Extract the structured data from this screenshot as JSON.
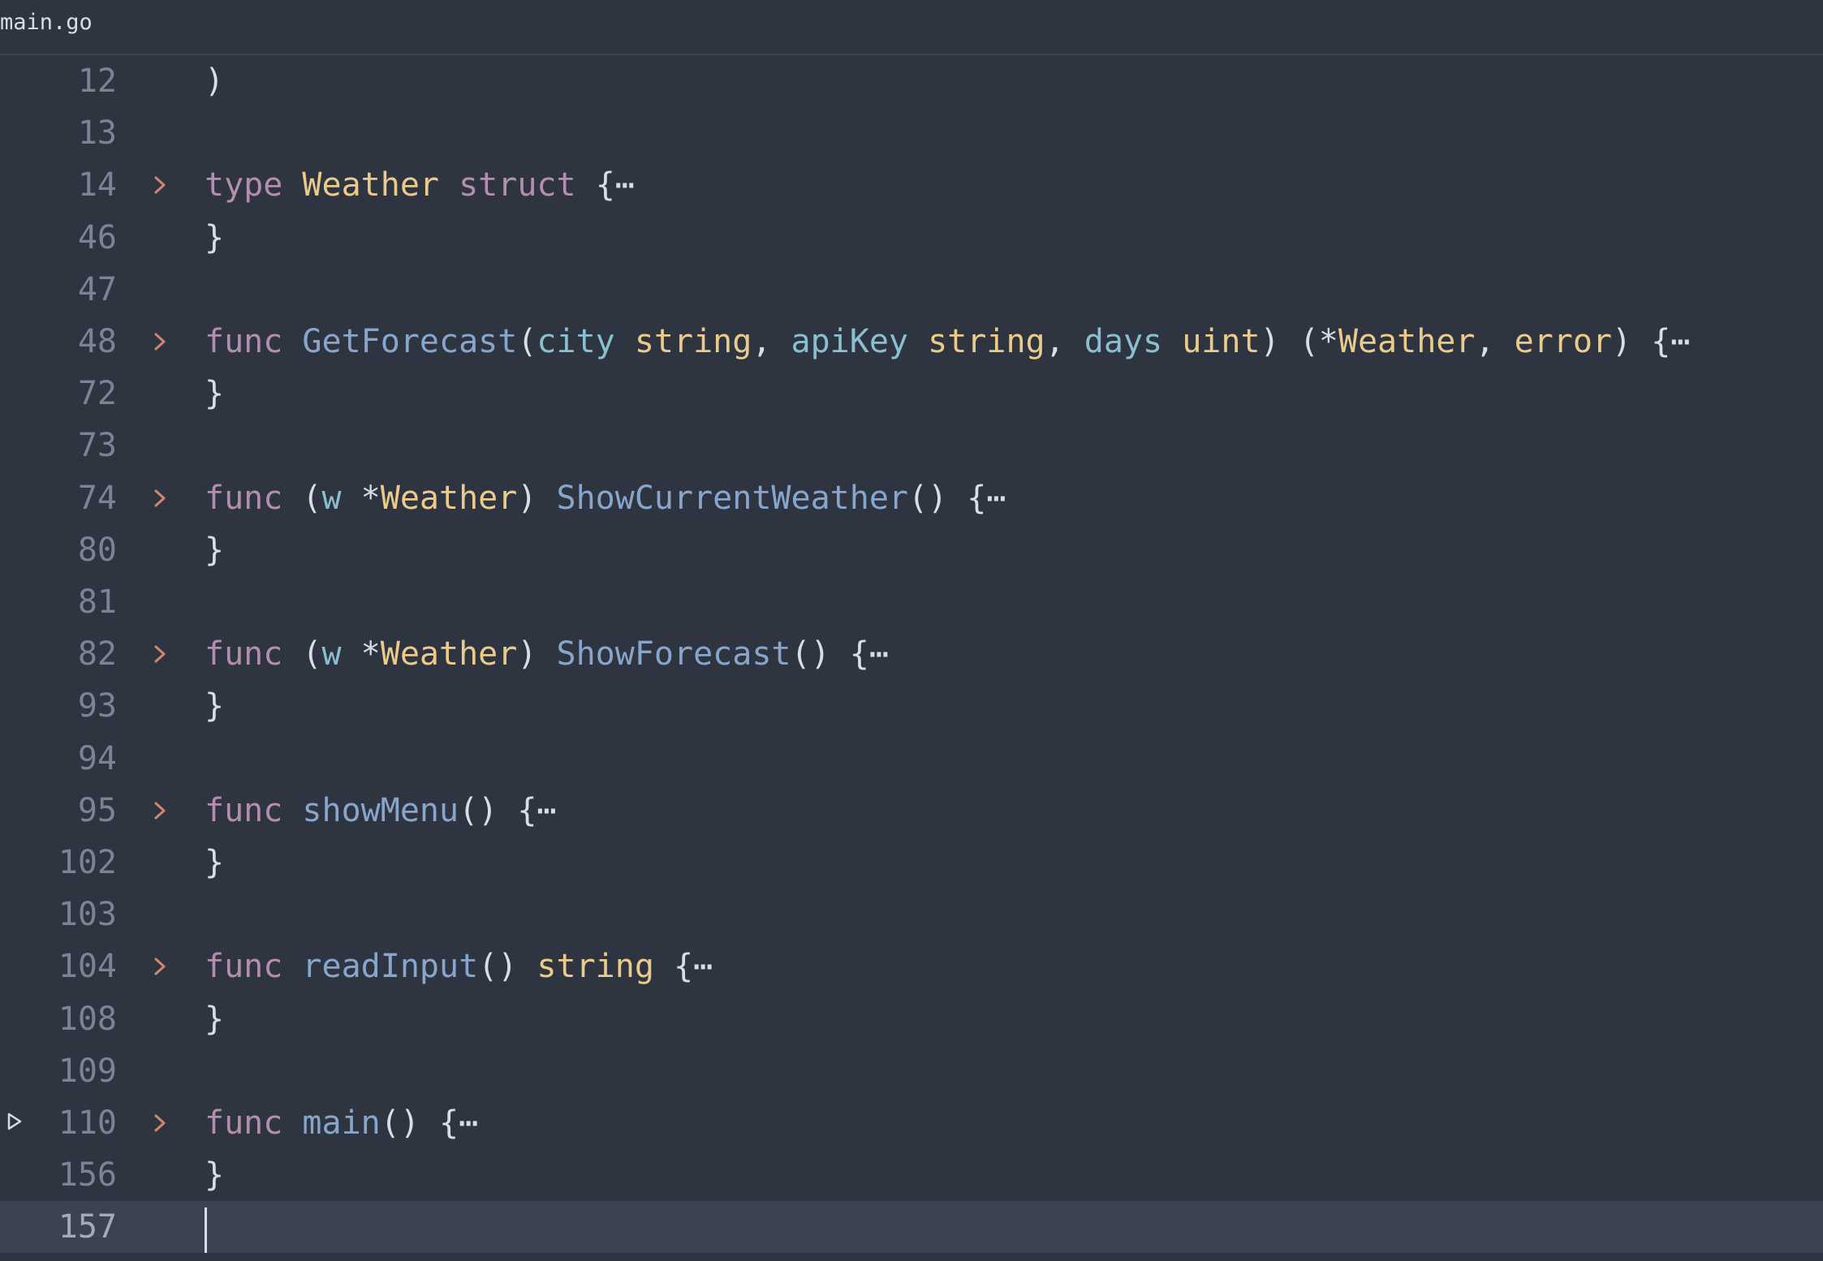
{
  "tab": {
    "title": "main.go"
  },
  "colors": {
    "background": "#2e3440",
    "current_line": "#3b4252",
    "keyword": "#b48ead",
    "type": "#ebcb8b",
    "function": "#88a6cc",
    "parameter": "#88c0d0",
    "fold_chevron": "#d08770"
  },
  "icons": {
    "fold": "chevron-right-icon",
    "run": "run-triangle-icon"
  },
  "ellipsis": "{⋯",
  "lines": [
    {
      "num": "12",
      "tokens": [
        {
          "t": ")",
          "c": "pu"
        }
      ]
    },
    {
      "num": "13",
      "tokens": []
    },
    {
      "num": "14",
      "fold": true,
      "tokens": [
        {
          "t": "type",
          "c": "kw"
        },
        {
          "t": " ",
          "c": "pu"
        },
        {
          "t": "Weather",
          "c": "ty"
        },
        {
          "t": " ",
          "c": "pu"
        },
        {
          "t": "struct",
          "c": "kw"
        },
        {
          "t": " ",
          "c": "pu"
        }
      ]
    },
    {
      "num": "46",
      "tokens": [
        {
          "t": "}",
          "c": "pu"
        }
      ]
    },
    {
      "num": "47",
      "tokens": []
    },
    {
      "num": "48",
      "fold": true,
      "tokens": [
        {
          "t": "func",
          "c": "kw"
        },
        {
          "t": " ",
          "c": "pu"
        },
        {
          "t": "GetForecast",
          "c": "fn"
        },
        {
          "t": "(",
          "c": "pu"
        },
        {
          "t": "city",
          "c": "pm"
        },
        {
          "t": " ",
          "c": "pu"
        },
        {
          "t": "string",
          "c": "ty"
        },
        {
          "t": ", ",
          "c": "pu"
        },
        {
          "t": "apiKey",
          "c": "pm"
        },
        {
          "t": " ",
          "c": "pu"
        },
        {
          "t": "string",
          "c": "ty"
        },
        {
          "t": ", ",
          "c": "pu"
        },
        {
          "t": "days",
          "c": "pm"
        },
        {
          "t": " ",
          "c": "pu"
        },
        {
          "t": "uint",
          "c": "ty"
        },
        {
          "t": ") (*",
          "c": "pu"
        },
        {
          "t": "Weather",
          "c": "ty"
        },
        {
          "t": ", ",
          "c": "pu"
        },
        {
          "t": "error",
          "c": "ty"
        },
        {
          "t": ") ",
          "c": "pu"
        }
      ]
    },
    {
      "num": "72",
      "tokens": [
        {
          "t": "}",
          "c": "pu"
        }
      ]
    },
    {
      "num": "73",
      "tokens": []
    },
    {
      "num": "74",
      "fold": true,
      "tokens": [
        {
          "t": "func",
          "c": "kw"
        },
        {
          "t": " (",
          "c": "pu"
        },
        {
          "t": "w",
          "c": "pm"
        },
        {
          "t": " *",
          "c": "pu"
        },
        {
          "t": "Weather",
          "c": "ty"
        },
        {
          "t": ") ",
          "c": "pu"
        },
        {
          "t": "ShowCurrentWeather",
          "c": "fn"
        },
        {
          "t": "() ",
          "c": "pu"
        }
      ]
    },
    {
      "num": "80",
      "tokens": [
        {
          "t": "}",
          "c": "pu"
        }
      ]
    },
    {
      "num": "81",
      "tokens": []
    },
    {
      "num": "82",
      "fold": true,
      "tokens": [
        {
          "t": "func",
          "c": "kw"
        },
        {
          "t": " (",
          "c": "pu"
        },
        {
          "t": "w",
          "c": "pm"
        },
        {
          "t": " *",
          "c": "pu"
        },
        {
          "t": "Weather",
          "c": "ty"
        },
        {
          "t": ") ",
          "c": "pu"
        },
        {
          "t": "ShowForecast",
          "c": "fn"
        },
        {
          "t": "() ",
          "c": "pu"
        }
      ]
    },
    {
      "num": "93",
      "tokens": [
        {
          "t": "}",
          "c": "pu"
        }
      ]
    },
    {
      "num": "94",
      "tokens": []
    },
    {
      "num": "95",
      "fold": true,
      "tokens": [
        {
          "t": "func",
          "c": "kw"
        },
        {
          "t": " ",
          "c": "pu"
        },
        {
          "t": "showMenu",
          "c": "fn"
        },
        {
          "t": "() ",
          "c": "pu"
        }
      ]
    },
    {
      "num": "102",
      "tokens": [
        {
          "t": "}",
          "c": "pu"
        }
      ]
    },
    {
      "num": "103",
      "tokens": []
    },
    {
      "num": "104",
      "fold": true,
      "tokens": [
        {
          "t": "func",
          "c": "kw"
        },
        {
          "t": " ",
          "c": "pu"
        },
        {
          "t": "readInput",
          "c": "fn"
        },
        {
          "t": "() ",
          "c": "pu"
        },
        {
          "t": "string",
          "c": "ty"
        },
        {
          "t": " ",
          "c": "pu"
        }
      ]
    },
    {
      "num": "108",
      "tokens": [
        {
          "t": "}",
          "c": "pu"
        }
      ]
    },
    {
      "num": "109",
      "tokens": []
    },
    {
      "num": "110",
      "fold": true,
      "run": true,
      "tokens": [
        {
          "t": "func",
          "c": "kw"
        },
        {
          "t": " ",
          "c": "pu"
        },
        {
          "t": "main",
          "c": "fn"
        },
        {
          "t": "() ",
          "c": "pu"
        }
      ]
    },
    {
      "num": "156",
      "tokens": [
        {
          "t": "}",
          "c": "pu"
        }
      ]
    },
    {
      "num": "157",
      "current": true,
      "caret": true,
      "tokens": []
    }
  ]
}
